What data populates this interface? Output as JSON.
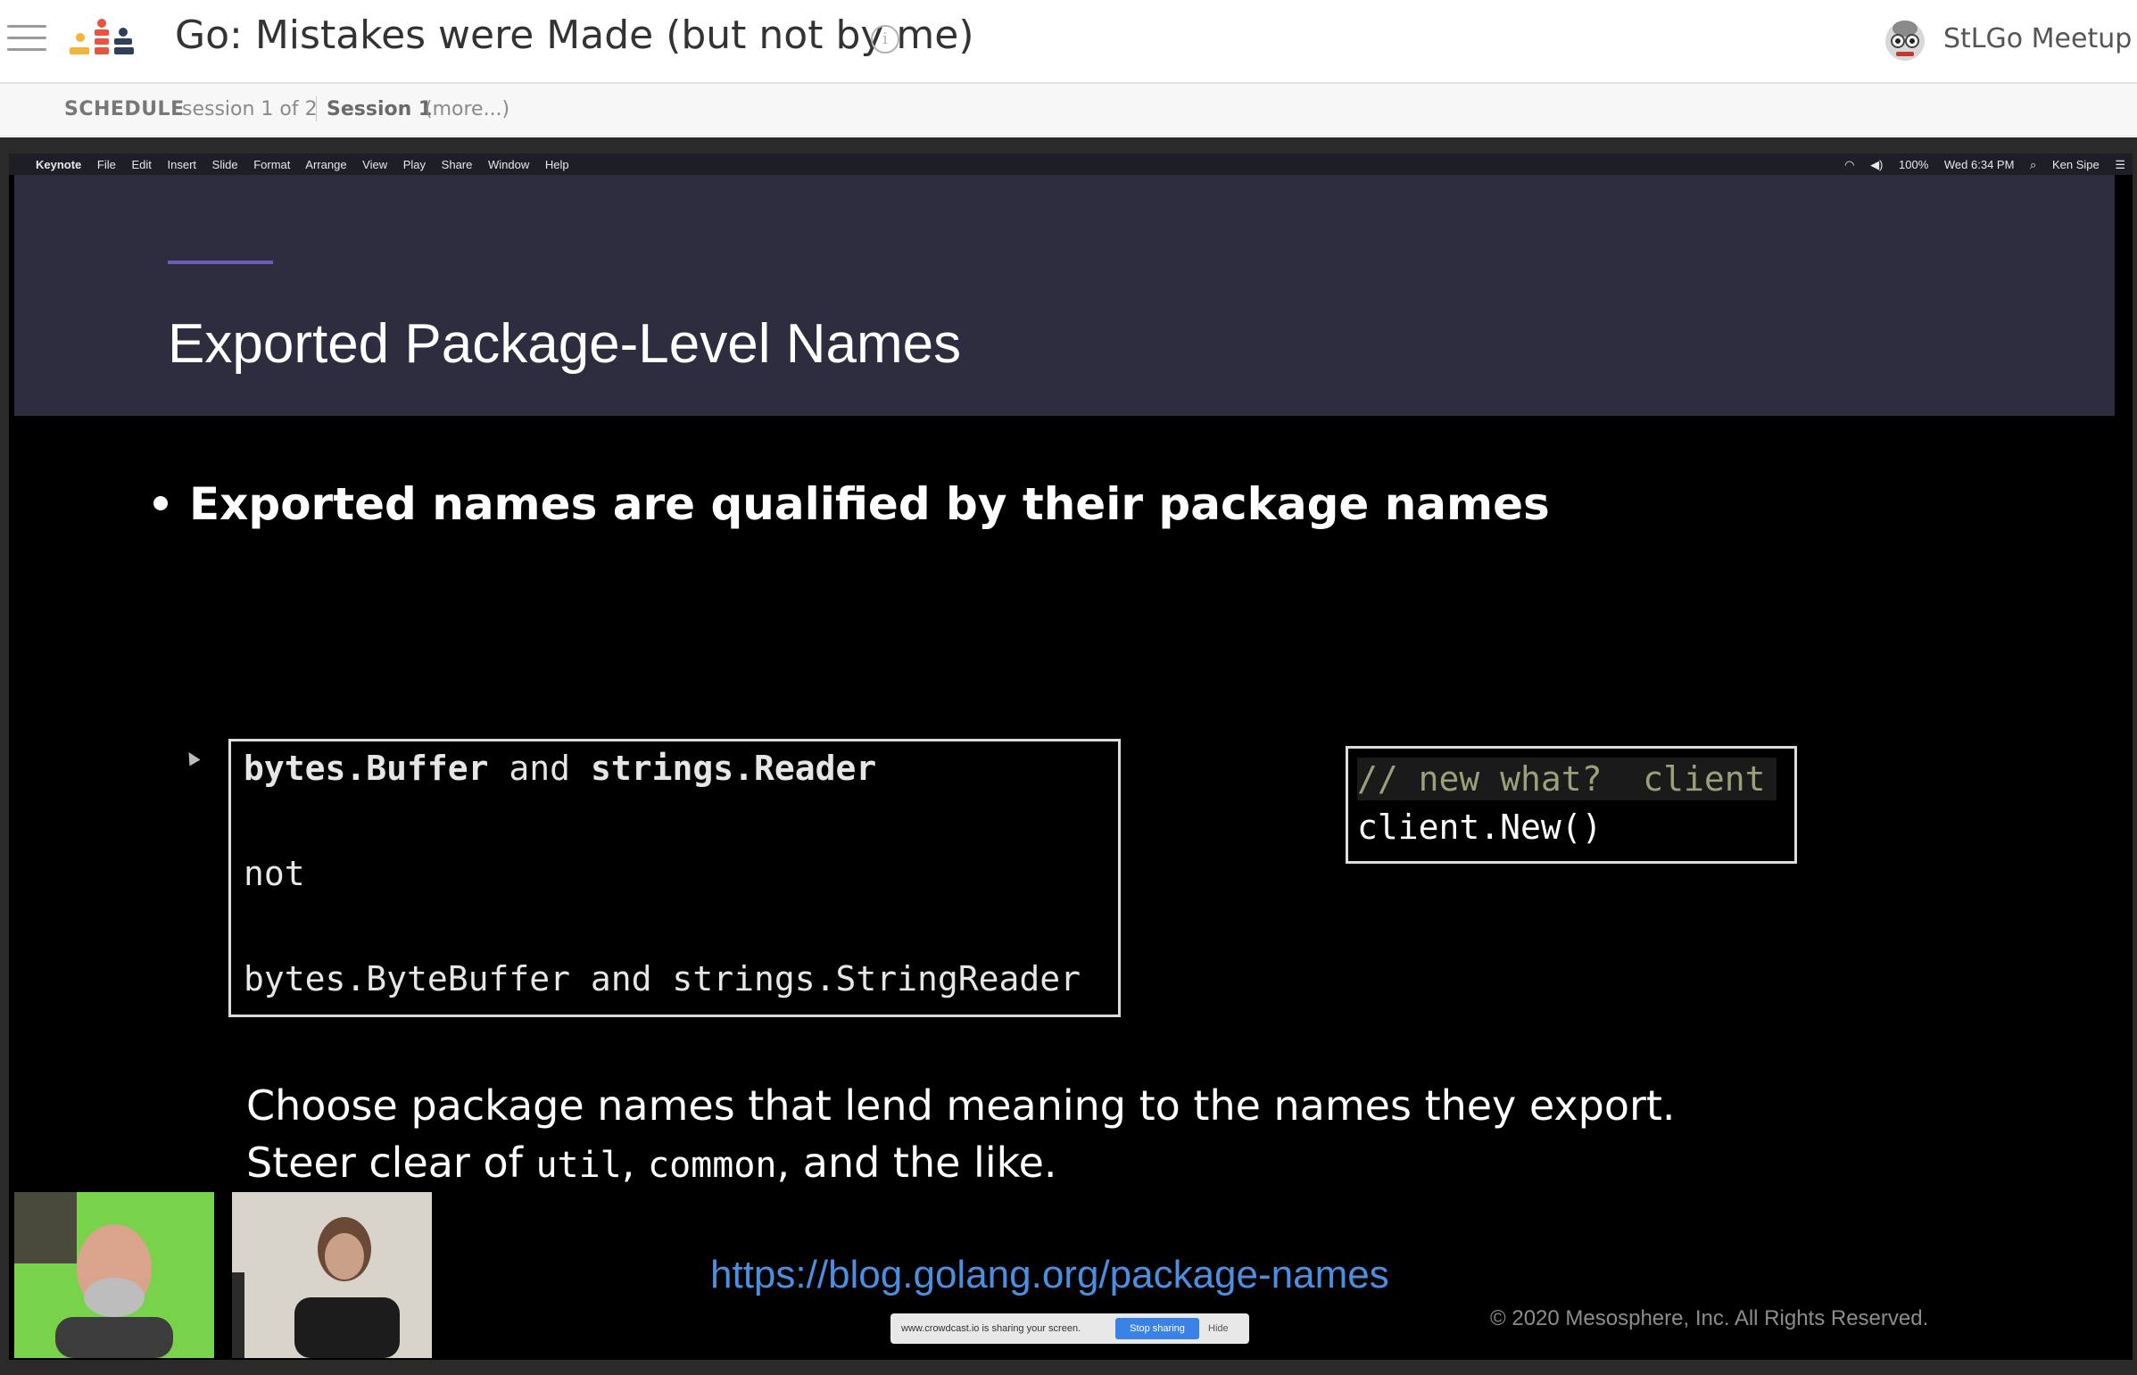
{
  "header": {
    "title": "Go: Mistakes were Made (but not by me)",
    "info_icon": "info-icon",
    "host_name": "StLGo Meetup"
  },
  "schedule": {
    "label": "SCHEDULE",
    "count": "session 1 of 2",
    "session": "Session 1",
    "more": "(more...)"
  },
  "macbar": {
    "app": "Keynote",
    "menus": [
      "File",
      "Edit",
      "Insert",
      "Slide",
      "Format",
      "Arrange",
      "View",
      "Play",
      "Share",
      "Window",
      "Help"
    ],
    "battery": "100%",
    "clock": "Wed 6:34 PM",
    "user": "Ken Sipe"
  },
  "slide": {
    "title": "Exported Package-Level Names",
    "bullet": "Exported names are qualified by their package names",
    "code1": {
      "line1_a": "bytes.Buffer",
      "line1_b": " and ",
      "line1_c": "strings.Reader",
      "line2": "not",
      "line3": "bytes.ByteBuffer and strings.StringReader"
    },
    "code2": {
      "comment": "// new what?  client",
      "call": "client.New()"
    },
    "para1": "Choose package names that lend meaning to the names they export.",
    "para2_a": "Steer clear of ",
    "para2_b": "util",
    "para2_c": ", ",
    "para2_d": "common",
    "para2_e": ", and the like.",
    "link": "https://blog.golang.org/package-names",
    "copyright": "© 2020 Mesosphere, Inc. All Rights Reserved."
  },
  "sharebar": {
    "message": "www.crowdcast.io is sharing your screen.",
    "stop": "Stop sharing",
    "hide": "Hide"
  },
  "colors": {
    "slide_header_bg": "#2d2d3f",
    "accent": "#6e5bb8",
    "link": "#4a8fe0"
  }
}
